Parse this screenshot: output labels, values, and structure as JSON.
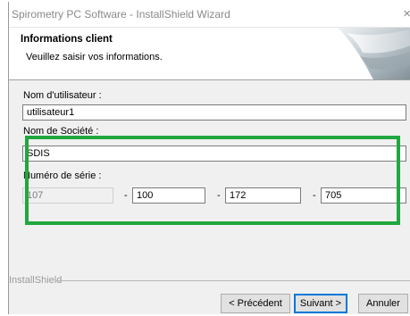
{
  "window": {
    "title": "Spirometry PC Software - InstallShield Wizard",
    "close_glyph": "×"
  },
  "banner": {
    "title": "Informations client",
    "subtitle": "Veuillez saisir vos informations."
  },
  "form": {
    "username_label": "Nom d'utilisateur :",
    "username_value": "utilisateur1",
    "company_label": "Nom de Société :",
    "company_value": "SDIS",
    "serial_label": "Numéro de série :",
    "serial_parts": [
      "107",
      "100",
      "172",
      "705"
    ],
    "serial_separator": "-"
  },
  "footer": {
    "brand": "InstallShield",
    "back_label": "< Précédent",
    "next_label": "Suivant >",
    "cancel_label": "Annuler"
  },
  "colors": {
    "highlight": "#1fa83f",
    "default_button_border": "#0078d7"
  },
  "icons": {
    "close": "close-icon",
    "banner": "installshield-banner-graphic"
  }
}
